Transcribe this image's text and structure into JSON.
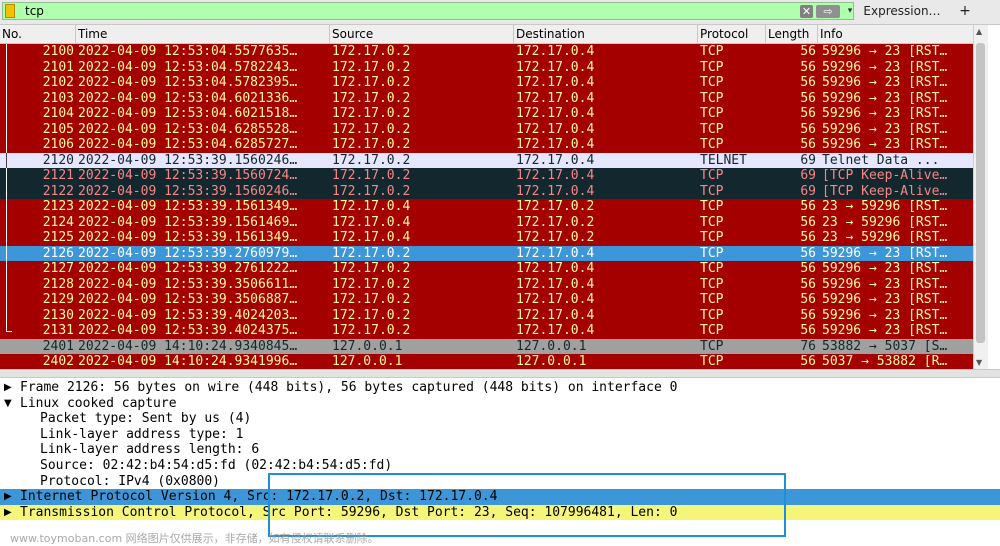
{
  "filter": {
    "text": "tcp",
    "expression_label": "Expression…",
    "add_label": "+",
    "clear_icon": "✕",
    "apply_icon": "⇨",
    "dropdown_icon": "▾",
    "bg_color": "#afffaf"
  },
  "columns": [
    "No.",
    "Time",
    "Source",
    "Destination",
    "Protocol",
    "Length",
    "Info"
  ],
  "colors": {
    "tcp_rst_bg": "#a40000",
    "tcp_rst_fg": "#fffc9c",
    "keepalive_bg": "#12272e",
    "keepalive_fg": "#f78787",
    "telnet_bg": "#e7e6ff",
    "telnet_fg": "#12272e",
    "gray_bg": "#a0a0a0",
    "gray_fg": "#12272e",
    "selected_bg": "#3c96d8",
    "selected_fg": "#ffffff",
    "detail_selected_bg": "#3c96d8",
    "detail_tcp_bg": "#f5f57a"
  },
  "packets": [
    {
      "no": "2100",
      "time": "2022-04-09 12:53:04.5577635…",
      "src": "172.17.0.2",
      "dst": "172.17.0.4",
      "proto": "TCP",
      "len": "56",
      "info": "59296 → 23 [RST…",
      "style": "rst"
    },
    {
      "no": "2101",
      "time": "2022-04-09 12:53:04.5782243…",
      "src": "172.17.0.2",
      "dst": "172.17.0.4",
      "proto": "TCP",
      "len": "56",
      "info": "59296 → 23 [RST…",
      "style": "rst"
    },
    {
      "no": "2102",
      "time": "2022-04-09 12:53:04.5782395…",
      "src": "172.17.0.2",
      "dst": "172.17.0.4",
      "proto": "TCP",
      "len": "56",
      "info": "59296 → 23 [RST…",
      "style": "rst"
    },
    {
      "no": "2103",
      "time": "2022-04-09 12:53:04.6021336…",
      "src": "172.17.0.2",
      "dst": "172.17.0.4",
      "proto": "TCP",
      "len": "56",
      "info": "59296 → 23 [RST…",
      "style": "rst"
    },
    {
      "no": "2104",
      "time": "2022-04-09 12:53:04.6021518…",
      "src": "172.17.0.2",
      "dst": "172.17.0.4",
      "proto": "TCP",
      "len": "56",
      "info": "59296 → 23 [RST…",
      "style": "rst"
    },
    {
      "no": "2105",
      "time": "2022-04-09 12:53:04.6285528…",
      "src": "172.17.0.2",
      "dst": "172.17.0.4",
      "proto": "TCP",
      "len": "56",
      "info": "59296 → 23 [RST…",
      "style": "rst"
    },
    {
      "no": "2106",
      "time": "2022-04-09 12:53:04.6285727…",
      "src": "172.17.0.2",
      "dst": "172.17.0.4",
      "proto": "TCP",
      "len": "56",
      "info": "59296 → 23 [RST…",
      "style": "rst"
    },
    {
      "no": "2120",
      "time": "2022-04-09 12:53:39.1560246…",
      "src": "172.17.0.2",
      "dst": "172.17.0.4",
      "proto": "TELNET",
      "len": "69",
      "info": "Telnet Data ...",
      "style": "telnet"
    },
    {
      "no": "2121",
      "time": "2022-04-09 12:53:39.1560724…",
      "src": "172.17.0.2",
      "dst": "172.17.0.4",
      "proto": "TCP",
      "len": "69",
      "info": "[TCP Keep-Alive…",
      "style": "keepalive"
    },
    {
      "no": "2122",
      "time": "2022-04-09 12:53:39.1560246…",
      "src": "172.17.0.2",
      "dst": "172.17.0.4",
      "proto": "TCP",
      "len": "69",
      "info": "[TCP Keep-Alive…",
      "style": "keepalive"
    },
    {
      "no": "2123",
      "time": "2022-04-09 12:53:39.1561349…",
      "src": "172.17.0.4",
      "dst": "172.17.0.2",
      "proto": "TCP",
      "len": "56",
      "info": "23 → 59296 [RST…",
      "style": "rst"
    },
    {
      "no": "2124",
      "time": "2022-04-09 12:53:39.1561469…",
      "src": "172.17.0.4",
      "dst": "172.17.0.2",
      "proto": "TCP",
      "len": "56",
      "info": "23 → 59296 [RST…",
      "style": "rst"
    },
    {
      "no": "2125",
      "time": "2022-04-09 12:53:39.1561349…",
      "src": "172.17.0.4",
      "dst": "172.17.0.2",
      "proto": "TCP",
      "len": "56",
      "info": "23 → 59296 [RST…",
      "style": "rst"
    },
    {
      "no": "2126",
      "time": "2022-04-09 12:53:39.2760979…",
      "src": "172.17.0.2",
      "dst": "172.17.0.4",
      "proto": "TCP",
      "len": "56",
      "info": "59296 → 23 [RST…",
      "style": "selected"
    },
    {
      "no": "2127",
      "time": "2022-04-09 12:53:39.2761222…",
      "src": "172.17.0.2",
      "dst": "172.17.0.4",
      "proto": "TCP",
      "len": "56",
      "info": "59296 → 23 [RST…",
      "style": "rst"
    },
    {
      "no": "2128",
      "time": "2022-04-09 12:53:39.3506611…",
      "src": "172.17.0.2",
      "dst": "172.17.0.4",
      "proto": "TCP",
      "len": "56",
      "info": "59296 → 23 [RST…",
      "style": "rst"
    },
    {
      "no": "2129",
      "time": "2022-04-09 12:53:39.3506887…",
      "src": "172.17.0.2",
      "dst": "172.17.0.4",
      "proto": "TCP",
      "len": "56",
      "info": "59296 → 23 [RST…",
      "style": "rst"
    },
    {
      "no": "2130",
      "time": "2022-04-09 12:53:39.4024203…",
      "src": "172.17.0.2",
      "dst": "172.17.0.4",
      "proto": "TCP",
      "len": "56",
      "info": "59296 → 23 [RST…",
      "style": "rst"
    },
    {
      "no": "2131",
      "time": "2022-04-09 12:53:39.4024375…",
      "src": "172.17.0.2",
      "dst": "172.17.0.4",
      "proto": "TCP",
      "len": "56",
      "info": "59296 → 23 [RST…",
      "style": "rst"
    },
    {
      "no": "2401",
      "time": "2022-04-09 14:10:24.9340845…",
      "src": "127.0.0.1",
      "dst": "127.0.0.1",
      "proto": "TCP",
      "len": "76",
      "info": "53882 → 5037 [S…",
      "style": "gray"
    },
    {
      "no": "2402",
      "time": "2022-04-09 14:10:24.9341996…",
      "src": "127.0.0.1",
      "dst": "127.0.0.1",
      "proto": "TCP",
      "len": "56",
      "info": "5037 → 53882 [R…",
      "style": "rst"
    }
  ],
  "details": [
    {
      "text": "Frame 2126: 56 bytes on wire (448 bits), 56 bytes captured (448 bits) on interface 0",
      "toggle": "▶",
      "indent": 0,
      "style": "normal"
    },
    {
      "text": "Linux cooked capture",
      "toggle": "▼",
      "indent": 0,
      "style": "normal"
    },
    {
      "text": "Packet type: Sent by us (4)",
      "toggle": "",
      "indent": 1,
      "style": "normal"
    },
    {
      "text": "Link-layer address type: 1",
      "toggle": "",
      "indent": 1,
      "style": "normal"
    },
    {
      "text": "Link-layer address length: 6",
      "toggle": "",
      "indent": 1,
      "style": "normal"
    },
    {
      "text": "Source: 02:42:b4:54:d5:fd (02:42:b4:54:d5:fd)",
      "toggle": "",
      "indent": 1,
      "style": "normal"
    },
    {
      "text": "Protocol: IPv4 (0x0800)",
      "toggle": "",
      "indent": 1,
      "style": "normal"
    },
    {
      "text": "Internet Protocol Version 4, Src: 172.17.0.2, Dst: 172.17.0.4",
      "toggle": "▶",
      "indent": 0,
      "style": "selected"
    },
    {
      "text": "Transmission Control Protocol, Src Port: 59296, Dst Port: 23, Seq: 107996481, Len: 0",
      "toggle": "▶",
      "indent": 0,
      "style": "tcp"
    }
  ],
  "watermark": "www.toymoban.com 网络图片仅供展示，非存储，如有侵权请联系删除。"
}
